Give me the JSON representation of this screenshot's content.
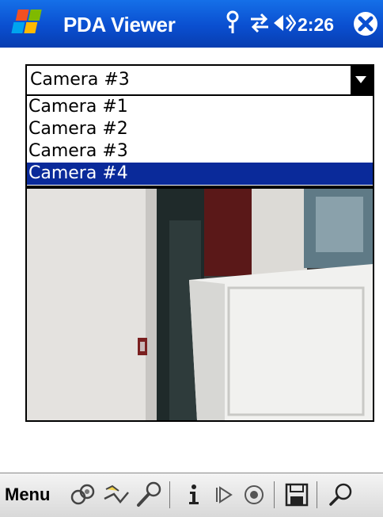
{
  "title_bar": {
    "app_title": "PDA Viewer",
    "time": "2:26"
  },
  "camera_select": {
    "selected_value": "Camera #3",
    "options": [
      "Camera #1",
      "Camera #2",
      "Camera #3",
      "Camera #4"
    ],
    "highlighted_option": "Camera #4"
  },
  "menu_bar": {
    "menu_label": "Menu",
    "icons": [
      "connect-icon",
      "disconnect-icon",
      "settings-icon",
      "info-icon",
      "play-icon",
      "record-icon",
      "save-icon",
      "zoom-icon"
    ]
  },
  "colors": {
    "title_bar": "#0a4fd0",
    "selection": "#0a2a9a",
    "menu_bar": "#e0e0e0"
  }
}
